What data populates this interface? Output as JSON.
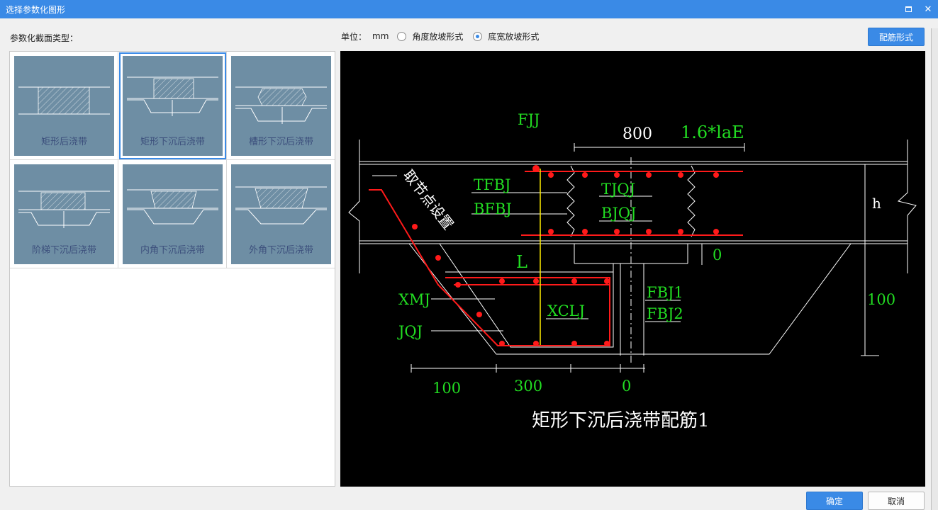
{
  "window": {
    "title": "选择参数化图形",
    "maximize_icon": "maximize-icon",
    "close_icon": "close-icon"
  },
  "left": {
    "label": "参数化截面类型："
  },
  "thumbnails": [
    {
      "label": "矩形后浇带",
      "selected": false
    },
    {
      "label": "矩形下沉后浇带",
      "selected": true
    },
    {
      "label": "槽形下沉后浇带",
      "selected": false
    },
    {
      "label": "阶梯下沉后浇带",
      "selected": false
    },
    {
      "label": "内角下沉后浇带",
      "selected": false
    },
    {
      "label": "外角下沉后浇带",
      "selected": false
    }
  ],
  "units": {
    "label": "单位：",
    "value": "mm",
    "options": [
      {
        "label": "角度放坡形式",
        "selected": false
      },
      {
        "label": "底宽放坡形式",
        "selected": true
      }
    ]
  },
  "buttons": {
    "rebar_form": "配筋形式",
    "ok": "确定",
    "cancel": "取消"
  },
  "drawing": {
    "caption": "矩形下沉后浇带配筋1",
    "dims": {
      "top_width": "800",
      "top_right": "1.6*laE",
      "h": "h",
      "right_height": "100",
      "offset_0_right": "0",
      "bottom_left": "100",
      "bottom_mid": "300",
      "bottom_right": "0",
      "L": "L"
    },
    "labels": {
      "fjj": "FJJ",
      "tfbj": "TFBJ",
      "bfbj": "BFBJ",
      "tjqj": "TJQJ",
      "bjqj": "BJQJ",
      "xmj": "XMJ",
      "jqj": "JQJ",
      "xclj": "XCLJ",
      "fbj1": "FBJ1",
      "fbj2": "FBJ2",
      "node_set": "取节点设置"
    },
    "colors": {
      "green": "#22dd22",
      "red": "#ff1a1a",
      "yellow": "#ffee00",
      "white": "#ffffff"
    }
  }
}
